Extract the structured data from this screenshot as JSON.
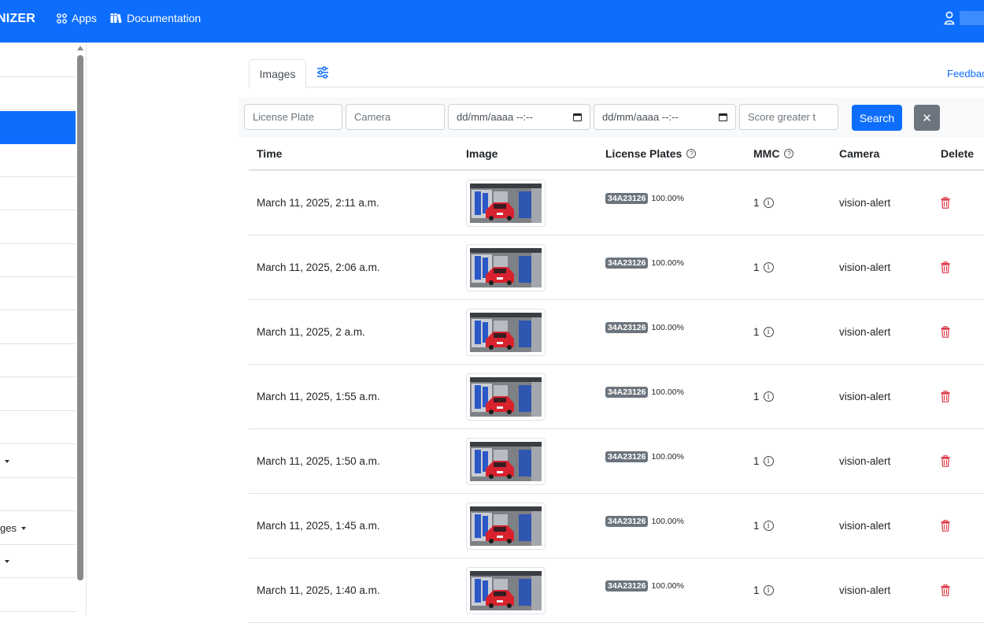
{
  "navbar": {
    "brand": "NIZER",
    "apps_label": "Apps",
    "docs_label": "Documentation",
    "apps_icon": "grid-icon",
    "docs_icon": "books-icon",
    "user_icon": "user-icon",
    "bg_color": "#0d6efd"
  },
  "sidebar": {
    "items": [
      {
        "label": ""
      },
      {
        "label": ""
      },
      {
        "label": "",
        "active": true
      },
      {
        "label": ""
      },
      {
        "label": ""
      },
      {
        "label": ""
      },
      {
        "label": ""
      },
      {
        "label": ""
      },
      {
        "label": ""
      },
      {
        "label": ""
      },
      {
        "label": ""
      },
      {
        "label": ""
      },
      {
        "label": ""
      },
      {
        "label": ""
      },
      {
        "label": "ges"
      },
      {
        "label": ""
      },
      {
        "label": ""
      }
    ]
  },
  "tabs": {
    "images_label": "Images",
    "filter_icon": "sliders-icon",
    "feedback_label": "Feedbac"
  },
  "filters": {
    "license_plate_placeholder": "License Plate",
    "camera_placeholder": "Camera",
    "date_from_placeholder": "dd/mm/aaaa --:--",
    "date_to_placeholder": "dd/mm/aaaa --:--",
    "score_placeholder": "Score greater t",
    "search_label": "Search",
    "clear_label": "✕"
  },
  "table": {
    "headers": {
      "time": "Time",
      "image": "Image",
      "plates": "License Plates",
      "mmc": "MMC",
      "camera": "Camera",
      "delete": "Delete"
    },
    "rows": [
      {
        "time": "March 11, 2025, 2:11 a.m.",
        "plate": "34A23126",
        "score": "100.00%",
        "mmc": "1",
        "camera": "vision-alert"
      },
      {
        "time": "March 11, 2025, 2:06 a.m.",
        "plate": "34A23126",
        "score": "100.00%",
        "mmc": "1",
        "camera": "vision-alert"
      },
      {
        "time": "March 11, 2025, 2 a.m.",
        "plate": "34A23126",
        "score": "100.00%",
        "mmc": "1",
        "camera": "vision-alert"
      },
      {
        "time": "March 11, 2025, 1:55 a.m.",
        "plate": "34A23126",
        "score": "100.00%",
        "mmc": "1",
        "camera": "vision-alert"
      },
      {
        "time": "March 11, 2025, 1:50 a.m.",
        "plate": "34A23126",
        "score": "100.00%",
        "mmc": "1",
        "camera": "vision-alert"
      },
      {
        "time": "March 11, 2025, 1:45 a.m.",
        "plate": "34A23126",
        "score": "100.00%",
        "mmc": "1",
        "camera": "vision-alert"
      },
      {
        "time": "March 11, 2025, 1:40 a.m.",
        "plate": "34A23126",
        "score": "100.00%",
        "mmc": "1",
        "camera": "vision-alert"
      }
    ]
  }
}
